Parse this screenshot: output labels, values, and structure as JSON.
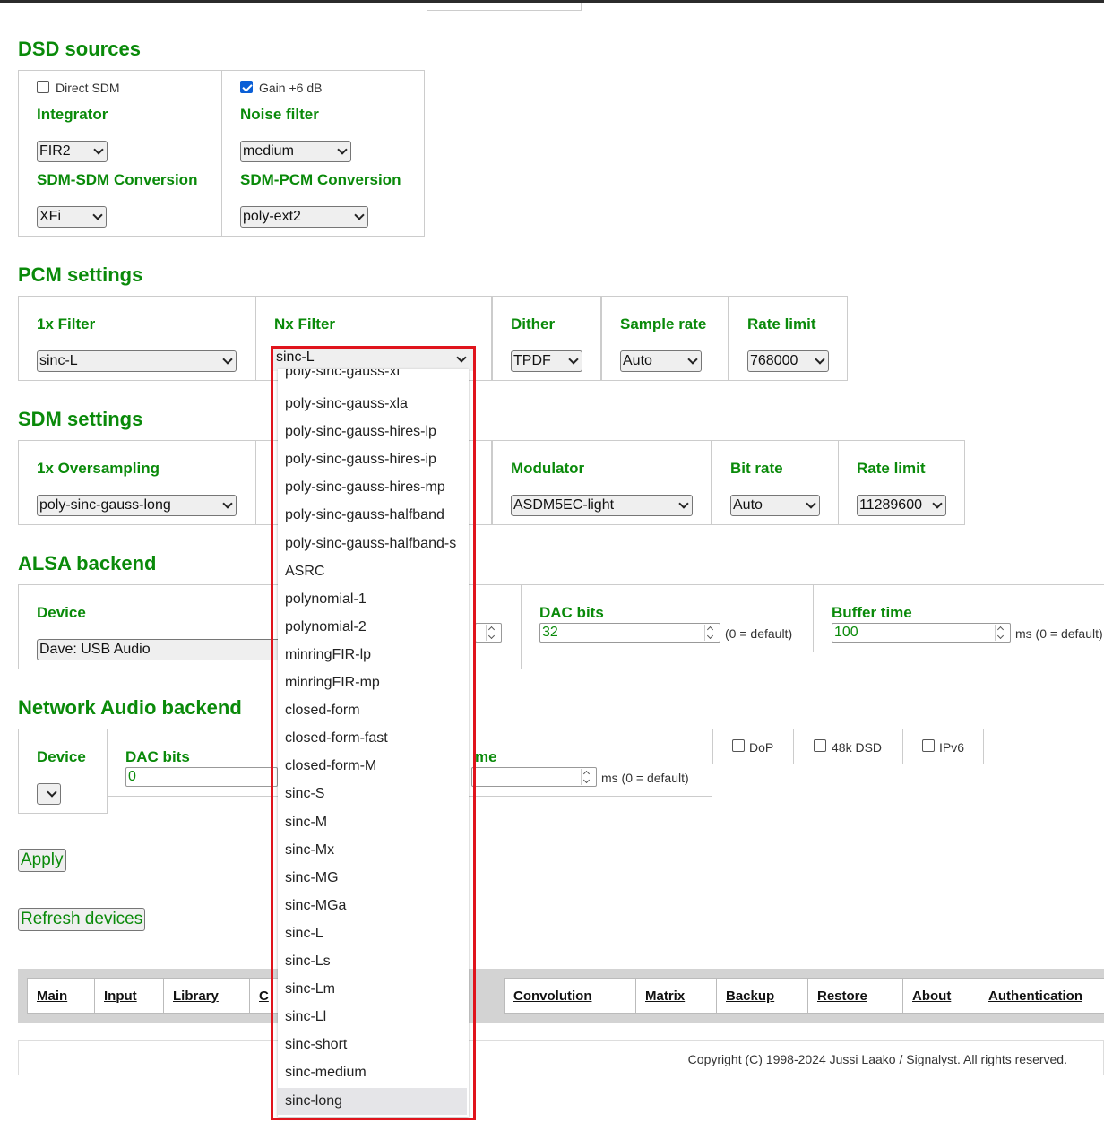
{
  "dsd": {
    "title": "DSD sources",
    "direct_sdm": "Direct SDM",
    "gain": "Gain +6 dB",
    "integrator_label": "Integrator",
    "integrator_value": "FIR2",
    "noise_filter_label": "Noise filter",
    "noise_filter_value": "medium",
    "sdm_sdm_label": "SDM-SDM Conversion",
    "sdm_sdm_value": "XFi",
    "sdm_pcm_label": "SDM-PCM Conversion",
    "sdm_pcm_value": "poly-ext2",
    "direct_sdm_checked": false,
    "gain_checked": true
  },
  "pcm": {
    "title": "PCM settings",
    "filter1x_label": "1x Filter",
    "filter1x_value": "sinc-L",
    "nx_label": "Nx Filter",
    "nx_value": "sinc-L",
    "dither_label": "Dither",
    "dither_value": "TPDF",
    "rate_label": "Sample rate",
    "rate_value": "Auto",
    "limit_label": "Rate limit",
    "limit_value": "768000"
  },
  "sdm": {
    "title": "SDM settings",
    "os_label": "1x Oversampling",
    "os_value": "poly-sinc-gauss-long",
    "mod_label": "Modulator",
    "mod_value": "ASDM5EC-light",
    "bit_label": "Bit rate",
    "bit_value": "Auto",
    "limit_label": "Rate limit",
    "limit_value": "11289600"
  },
  "alsa": {
    "title": "ALSA backend",
    "device_label": "Device",
    "device_value": "Dave: USB Audio",
    "dac_label": "DAC bits",
    "dac_value": "32",
    "dac_note": "(0 = default)",
    "buf_label": "Buffer time",
    "buf_value": "100",
    "buf_note": "ms (0 = default)"
  },
  "net": {
    "title": "Network Audio backend",
    "device_label": "Device",
    "dac_label": "DAC bits",
    "dac_value": "0",
    "buf_label_partial": "me",
    "buf_note": "ms (0 = default)",
    "dop": "DoP",
    "k48": "48k DSD",
    "ipv6": "IPv6"
  },
  "buttons": {
    "apply": "Apply",
    "refresh": "Refresh devices"
  },
  "nav": [
    "Main",
    "Input",
    "Library",
    "C",
    "Convolution",
    "Matrix",
    "Backup",
    "Restore",
    "About",
    "Authentication"
  ],
  "footer": "Copyright (C) 1998-2024 Jussi Laako / Signalyst. All rights reserved.",
  "dropdown": {
    "partial_top": "poly-sinc-gauss-xl",
    "items": [
      "poly-sinc-gauss-xla",
      "poly-sinc-gauss-hires-lp",
      "poly-sinc-gauss-hires-ip",
      "poly-sinc-gauss-hires-mp",
      "poly-sinc-gauss-halfband",
      "poly-sinc-gauss-halfband-s",
      "ASRC",
      "polynomial-1",
      "polynomial-2",
      "minringFIR-lp",
      "minringFIR-mp",
      "closed-form",
      "closed-form-fast",
      "closed-form-M",
      "sinc-S",
      "sinc-M",
      "sinc-Mx",
      "sinc-MG",
      "sinc-MGa",
      "sinc-L",
      "sinc-Ls",
      "sinc-Lm",
      "sinc-Ll",
      "sinc-short",
      "sinc-medium",
      "sinc-long"
    ],
    "highlighted": "sinc-long"
  }
}
